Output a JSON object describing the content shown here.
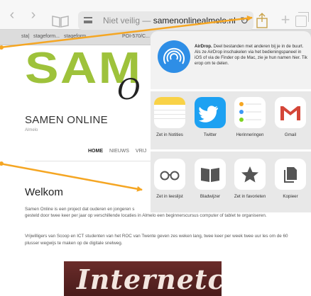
{
  "toolbar": {
    "url_prefix": "Niet veilig — ",
    "url_domain": "samenonlinealmelo.nl"
  },
  "tabs": [
    "sta|",
    "stageform...",
    "stageform...",
    "POI-570/C..."
  ],
  "page": {
    "logo": "SAM",
    "logo_script": "O",
    "site_title": "SAMEN ONLINE",
    "site_subtitle": "Almelo",
    "nav": [
      {
        "label": "HOME",
        "active": true
      },
      {
        "label": "NIEUWS",
        "active": false
      },
      {
        "label": "VRIJ",
        "active": false
      }
    ],
    "heading": "Welkom",
    "para1_a": "Samen Online is een project dat ouderen en jongeren s",
    "para1_b": "gesteld door twee keer per jaar op verschillende locaties in Almelo een beginnerscursus computer of tablet te organiseren.",
    "para2": "Vrijwilligers van Scoop en ICT studenten van het ROC van Twente geven zes weken lang, twee keer per week twee uur les om de 60 plusser wegwijs te maken op de digitale snelweg.",
    "photo_text": "Internetcafé"
  },
  "share_sheet": {
    "airdrop_title": "AirDrop.",
    "airdrop_desc": " Deel bestanden met anderen bij je in de buurt. Als ze AirDrop inschakelen via het bedieningspaneel in iOS of via de Finder op de Mac, zie je hun namen hier. Tik erop om te delen.",
    "apps": [
      {
        "label": "Zet in Notities",
        "icon": "notes-icon"
      },
      {
        "label": "Twitter",
        "icon": "twitter-icon"
      },
      {
        "label": "Herinneringen",
        "icon": "reminders-icon"
      },
      {
        "label": "Gmail",
        "icon": "gmail-icon"
      }
    ],
    "actions": [
      {
        "label": "Zet in leeslijst",
        "icon": "reading-list-icon"
      },
      {
        "label": "Bladwijzer",
        "icon": "bookmark-icon"
      },
      {
        "label": "Zet in favorieten",
        "icon": "star-icon"
      },
      {
        "label": "Kopieer",
        "icon": "copy-icon"
      }
    ]
  },
  "colors": {
    "annotation_arrow": "#f5a623",
    "logo_green": "#9ec23b",
    "twitter_blue": "#1da1f2",
    "gmail_red": "#d44638"
  }
}
